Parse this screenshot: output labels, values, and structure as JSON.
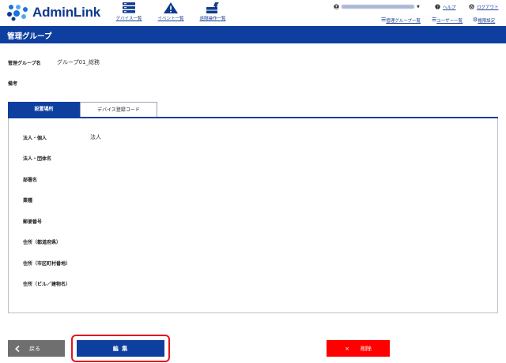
{
  "app": {
    "logo_text": "AdminLink"
  },
  "nav": [
    {
      "label": "デバイス一覧",
      "icon": "server-icon"
    },
    {
      "label": "イベント一覧",
      "icon": "warning-icon"
    },
    {
      "label": "遠隔操作一覧",
      "icon": "remote-icon"
    }
  ],
  "user_menu": {
    "help": "ヘルプ",
    "logout": "ログアウト",
    "group_list": "管理グループ一覧",
    "user_list": "ユーザー一覧",
    "permissions": "権限設定"
  },
  "page": {
    "title": "管理グループ"
  },
  "group": {
    "name_label": "管理グループ名",
    "name_value": "グループ01_総務",
    "note_label": "備考",
    "note_value": ""
  },
  "tabs": [
    {
      "label": "設置場所",
      "active": true
    },
    {
      "label": "デバイス登録コード",
      "active": false
    }
  ],
  "location_fields": [
    {
      "label": "法人・個人",
      "value": "法人"
    },
    {
      "label": "法人・団体名",
      "value": ""
    },
    {
      "label": "部署名",
      "value": ""
    },
    {
      "label": "業種",
      "value": ""
    },
    {
      "label": "郵便番号",
      "value": ""
    },
    {
      "label": "住所（都道府県）",
      "value": ""
    },
    {
      "label": "住所（市区町村番地）",
      "value": ""
    },
    {
      "label": "住所（ビル／建物名）",
      "value": ""
    }
  ],
  "buttons": {
    "back": "戻る",
    "edit": "編 集",
    "delete": "削除",
    "delete_mark": "×"
  },
  "colors": {
    "primary": "#0e3f9e",
    "danger": "#ff0000",
    "highlight": "#e3151b",
    "back_btn": "#6f6f6f"
  }
}
